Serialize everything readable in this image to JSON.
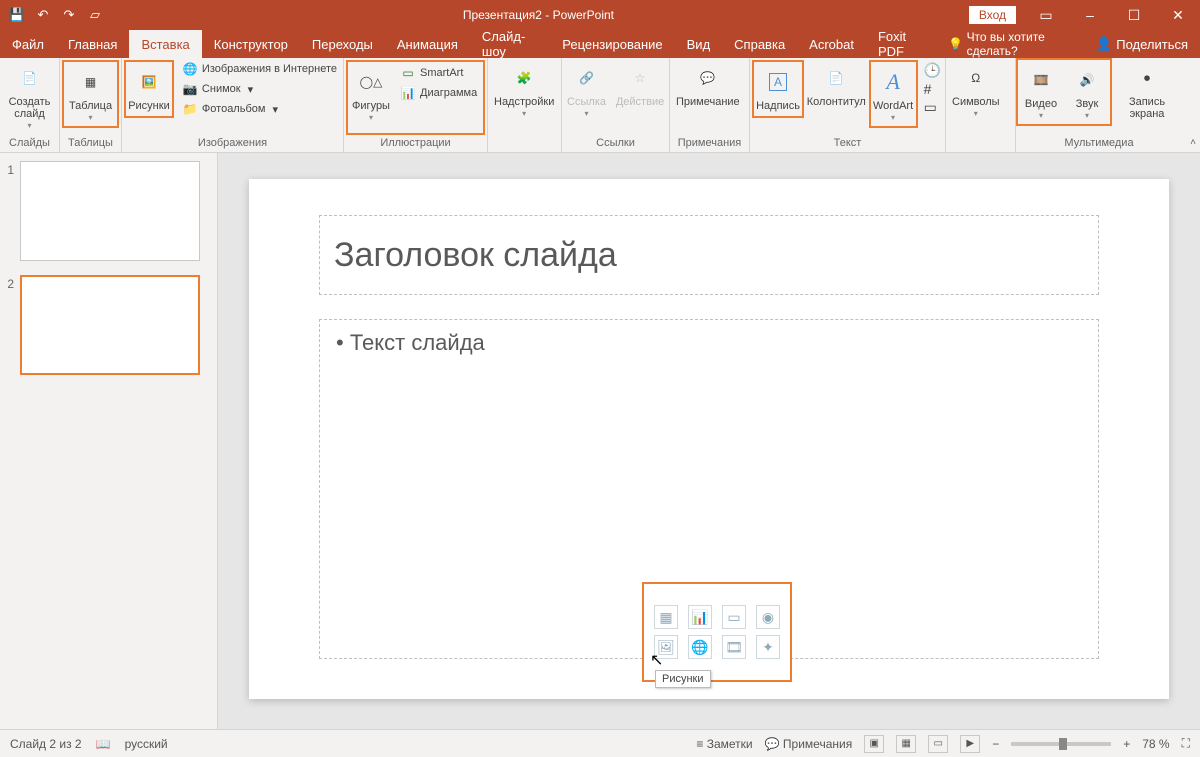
{
  "titlebar": {
    "title": "Презентация2 - PowerPoint",
    "login": "Вход"
  },
  "tabs": {
    "file": "Файл",
    "home": "Главная",
    "insert": "Вставка",
    "design": "Конструктор",
    "transitions": "Переходы",
    "animations": "Анимация",
    "slideshow": "Слайд-шоу",
    "review": "Рецензирование",
    "view": "Вид",
    "help": "Справка",
    "acrobat": "Acrobat",
    "foxit": "Foxit PDF",
    "tell": "Что вы хотите сделать?",
    "share": "Поделиться"
  },
  "ribbon": {
    "newslide": "Создать слайд",
    "slides_grp": "Слайды",
    "table": "Таблица",
    "tables_grp": "Таблицы",
    "pictures": "Рисунки",
    "online_images": "Изображения в Интернете",
    "screenshot": "Снимок",
    "photo_album": "Фотоальбом",
    "images_grp": "Изображения",
    "shapes": "Фигуры",
    "smartart": "SmartArt",
    "chart": "Диаграмма",
    "illus_grp": "Иллюстрации",
    "addins": "Надстройки",
    "link": "Ссылка",
    "action": "Действие",
    "links_grp": "Ссылки",
    "comment": "Примечание",
    "comments_grp": "Примечания",
    "textbox": "Надпись",
    "headerfooter": "Колонтитул",
    "wordart": "WordArt",
    "text_grp": "Текст",
    "symbols": "Символы",
    "video": "Видео",
    "audio": "Звук",
    "screenrec": "Запись экрана",
    "media_grp": "Мультимедиа"
  },
  "slide": {
    "title_ph": "Заголовок слайда",
    "body_ph": "Текст слайда",
    "tooltip": "Рисунки"
  },
  "thumbs": {
    "n1": "1",
    "n2": "2"
  },
  "status": {
    "slide": "Слайд 2 из 2",
    "lang": "русский",
    "notes": "Заметки",
    "comments": "Примечания",
    "zoom": "78 %"
  }
}
